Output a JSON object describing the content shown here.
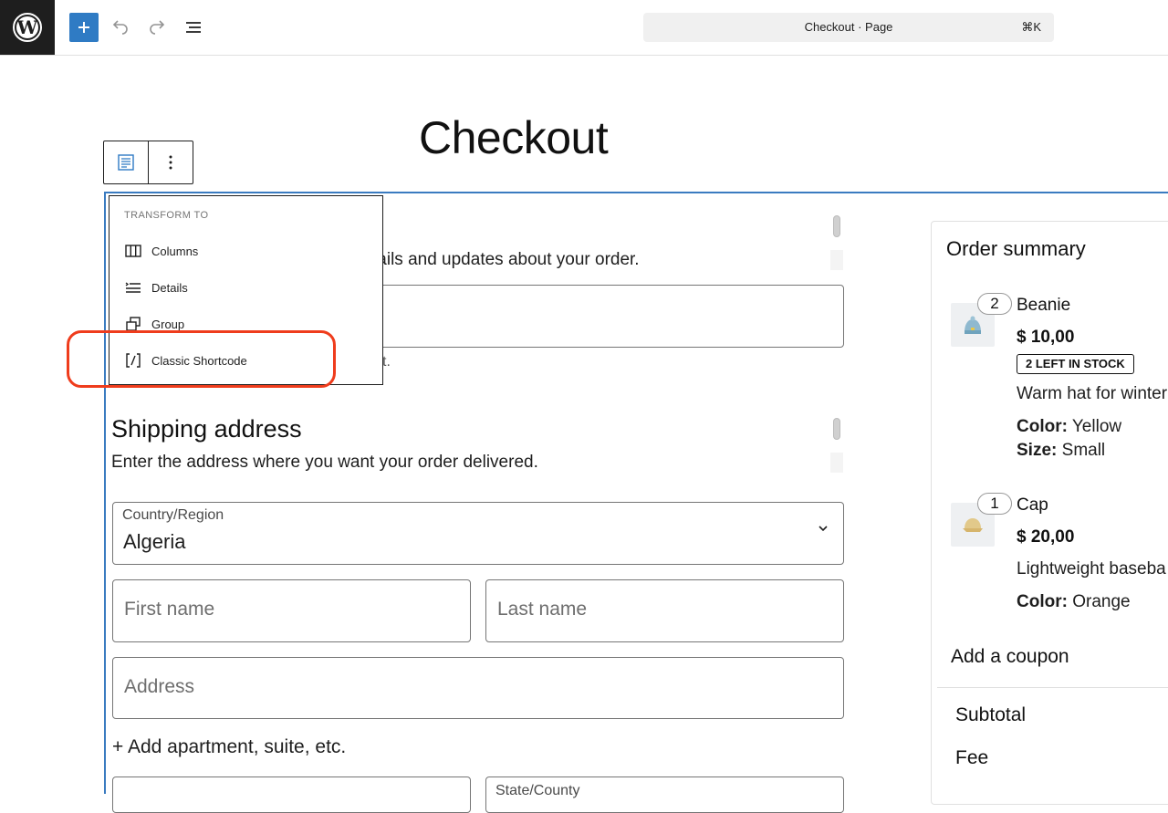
{
  "toolbar": {
    "document_title": "Checkout · Page",
    "shortcut": "⌘K"
  },
  "page": {
    "title": "Checkout"
  },
  "contact": {
    "description_partial": "tails and updates about your order.",
    "hint_partial": "t."
  },
  "transform_menu": {
    "heading": "TRANSFORM TO",
    "items": [
      {
        "label": "Columns",
        "icon": "columns-icon"
      },
      {
        "label": "Details",
        "icon": "details-icon"
      },
      {
        "label": "Group",
        "icon": "group-icon"
      },
      {
        "label": "Classic Shortcode",
        "icon": "shortcode-icon"
      }
    ]
  },
  "shipping": {
    "heading": "Shipping address",
    "description": "Enter the address where you want your order delivered.",
    "country_label": "Country/Region",
    "country_value": "Algeria",
    "first_name_placeholder": "First name",
    "last_name_placeholder": "Last name",
    "address_placeholder": "Address",
    "add_apartment": "+ Add apartment, suite, etc.",
    "state_label": "State/County"
  },
  "summary": {
    "title": "Order summary",
    "items": [
      {
        "qty": "2",
        "name": "Beanie",
        "price": "$ 10,00",
        "stock": "2 LEFT IN STOCK",
        "description": "Warm hat for winter",
        "attributes": [
          {
            "key": "Color:",
            "value": "Yellow"
          },
          {
            "key": "Size:",
            "value": "Small"
          }
        ]
      },
      {
        "qty": "1",
        "name": "Cap",
        "price": "$ 20,00",
        "description": "Lightweight baseba",
        "attributes": [
          {
            "key": "Color:",
            "value": "Orange"
          }
        ]
      }
    ],
    "coupon": "Add a coupon",
    "subtotal_label": "Subtotal",
    "fee_label": "Fee"
  },
  "colors": {
    "accent": "#2f7bc4",
    "highlight": "#ef3c1c"
  }
}
